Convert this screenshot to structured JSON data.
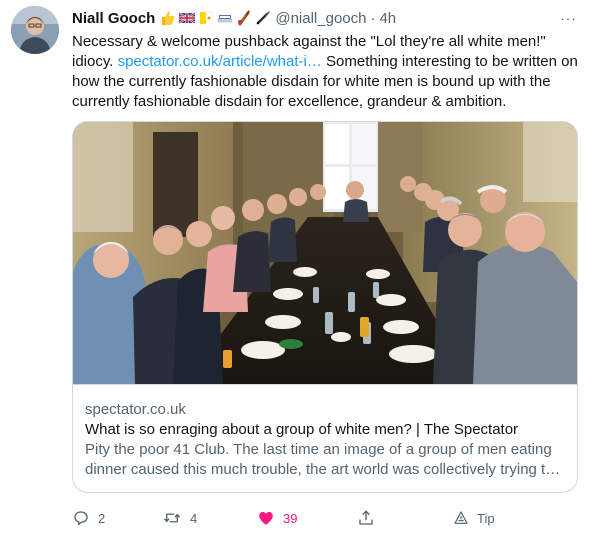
{
  "tweet": {
    "author_name": "Niall Gooch",
    "handle": "@niall_gooch",
    "separator": "·",
    "time": "4h",
    "emojis": [
      "thumbs-up-icon",
      "uk-flag-icon",
      "vatican-flag-icon",
      "cricket-bat-icon",
      "cricket-stump-icon",
      "pen-icon"
    ],
    "more_label": "···",
    "text_before_link": "Necessary & welcome pushback against the \"Lol they're all white men!\" idiocy. ",
    "link_text": "spectator.co.uk/article/what-i…",
    "text_after_link": " Something interesting to be written on how the currently fashionable disdain for white men is bound up with the currently fashionable disdain for excellence, grandeur & ambition."
  },
  "card": {
    "domain": "spectator.co.uk",
    "title": "What is so enraging about a group of white men? | The Spectator",
    "description": "Pity the poor 41 Club. The last time an image of a group of men eating dinner caused this much trouble, the art world was collectively trying t…",
    "image": "group-dinner-photo"
  },
  "actions": {
    "reply_count": "2",
    "retweet_count": "4",
    "like_count": "39",
    "share_icon": "share-icon",
    "tip_label": "Tip"
  },
  "colors": {
    "link": "#1d9bf0",
    "secondary_text": "#536471",
    "like": "#f91880",
    "border": "#cfd9de"
  }
}
